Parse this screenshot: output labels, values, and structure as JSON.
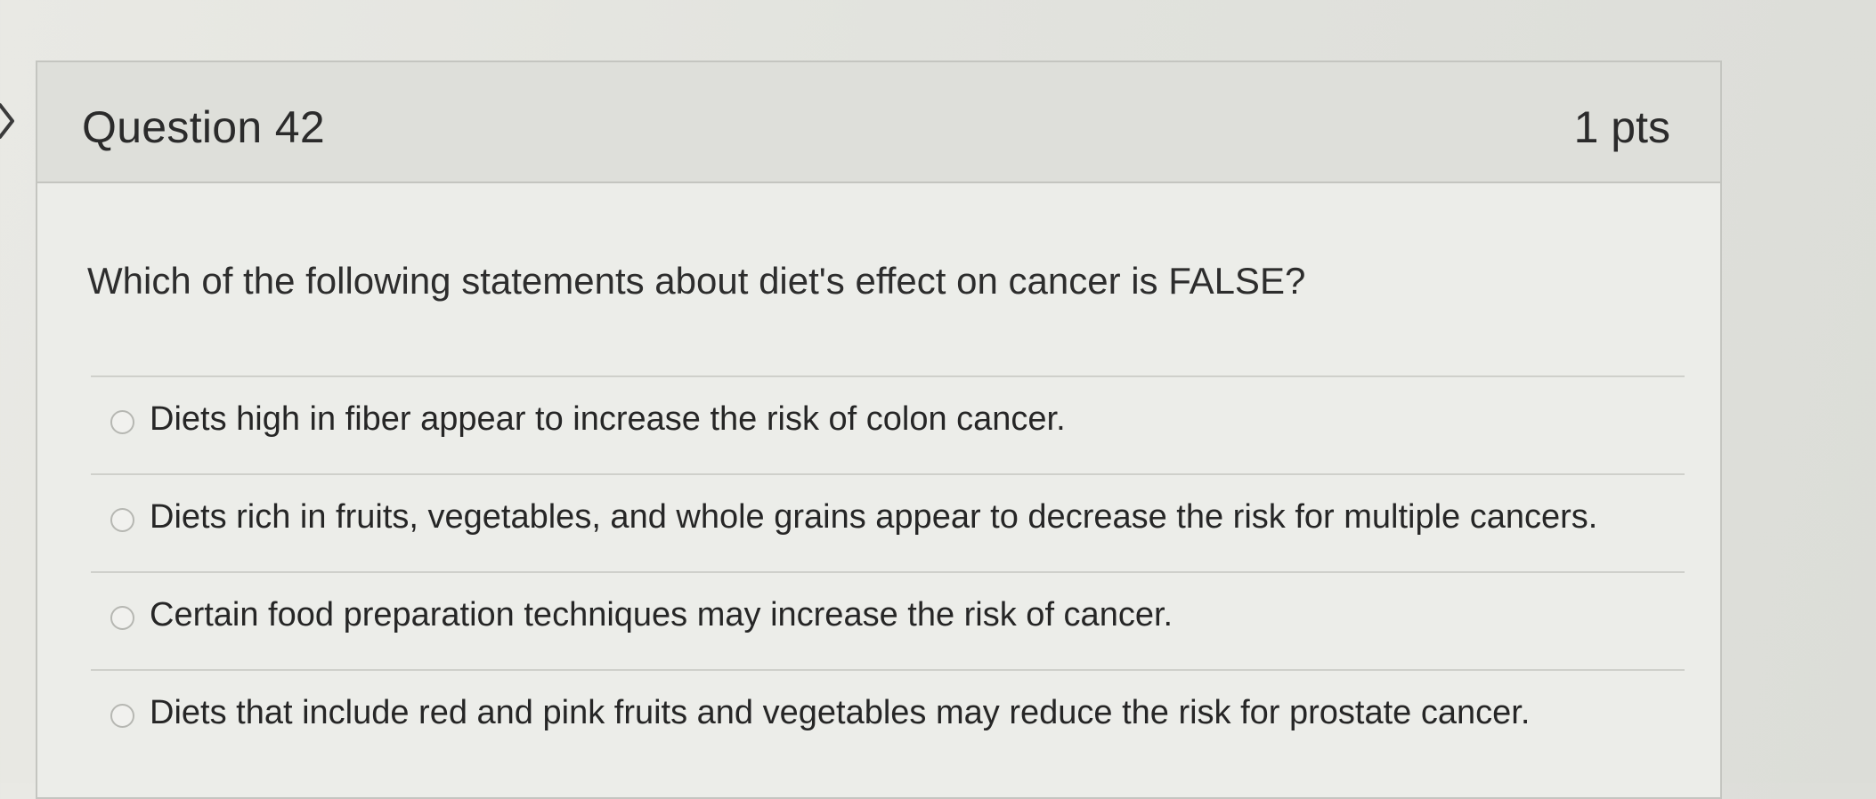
{
  "question": {
    "title": "Question 42",
    "points": "1 pts",
    "text": "Which of the following statements about diet's effect on cancer is FALSE?",
    "answers": [
      {
        "label": "Diets high in fiber appear to increase the risk of colon cancer."
      },
      {
        "label": "Diets rich in fruits, vegetables, and whole grains appear to decrease the risk for multiple cancers."
      },
      {
        "label": "Certain food preparation techniques may increase the risk of cancer."
      },
      {
        "label": "Diets that include red and pink fruits and vegetables may reduce the risk for prostate cancer."
      }
    ]
  },
  "icons": {
    "nav": "chevron-right-icon",
    "answer": "radio-button-icon"
  },
  "colors": {
    "background": "#e4e5e0",
    "header": "#dedfda",
    "text": "#2b2b2b",
    "border": "#c4c5c0"
  }
}
